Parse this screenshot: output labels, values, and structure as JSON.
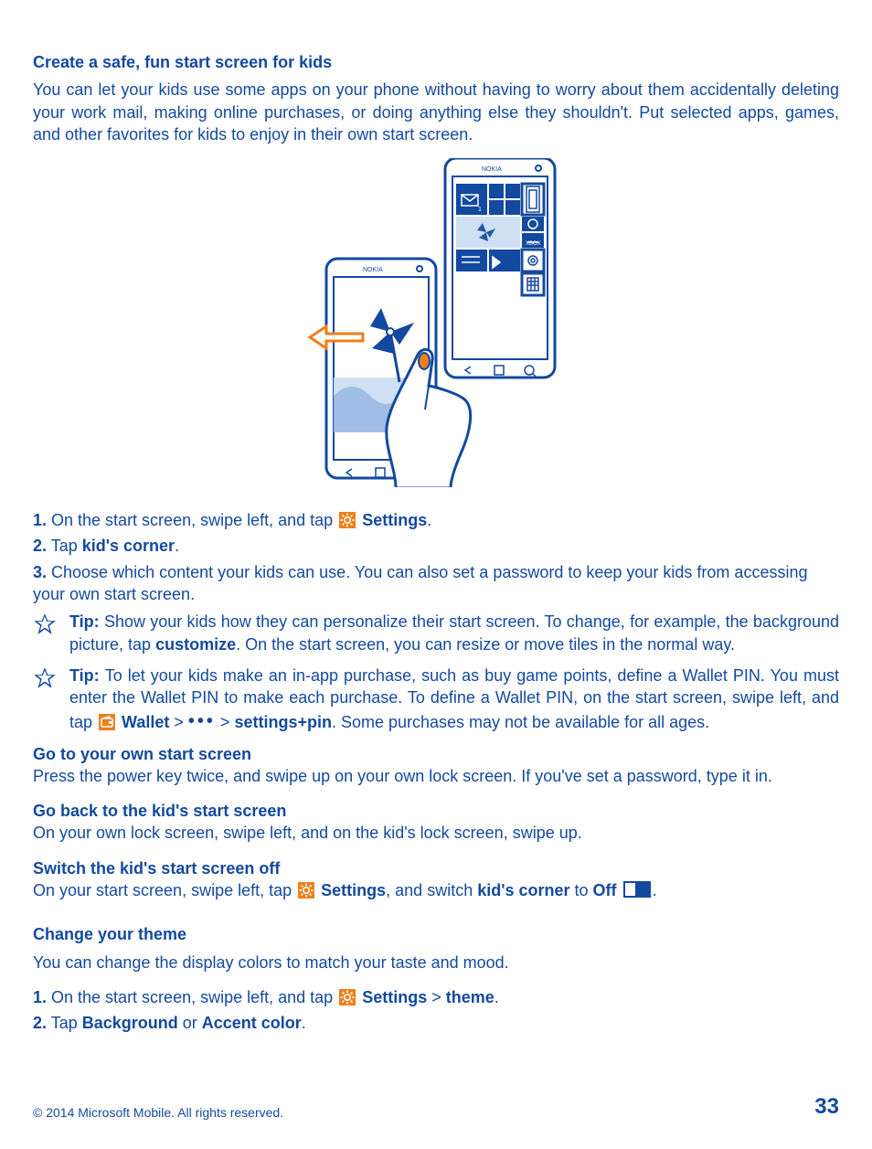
{
  "section1": {
    "heading": "Create a safe, fun start screen for kids",
    "intro": "You can let your kids use some apps on your phone without having to worry about them accidentally deleting your work mail, making online purchases, or doing anything else they shouldn't. Put selected apps, games, and other favorites for kids to enjoy in their own start screen.",
    "step1_a": "1.",
    "step1_b": " On the start screen, swipe left, and tap ",
    "step1_c": "Settings",
    "step1_d": ".",
    "step2_a": "2.",
    "step2_b": " Tap ",
    "step2_c": "kid's corner",
    "step2_d": ".",
    "step3_a": "3.",
    "step3_b": " Choose which content your kids can use. You can also set a password to keep your kids from accessing your own start screen.",
    "tip1_a": "Tip: ",
    "tip1_b": "Show your kids how they can personalize their start screen. To change, for example, the background picture, tap ",
    "tip1_c": "customize",
    "tip1_d": ". On the start screen, you can resize or move tiles in the normal way.",
    "tip2_a": "Tip: ",
    "tip2_b": "To let your kids make an in-app purchase, such as buy game points, define a Wallet PIN. You must enter the Wallet PIN to make each purchase. To define a Wallet PIN, on the start screen, swipe left, and tap ",
    "tip2_c": "Wallet",
    "tip2_d": " > ",
    "tip2_e": " > ",
    "tip2_f": "settings+pin",
    "tip2_g": ". Some purchases may not be available for all ages."
  },
  "sub1": {
    "head": "Go to your own start screen",
    "body": "Press the power key twice, and swipe up on your own lock screen. If you've set a password, type it in."
  },
  "sub2": {
    "head": "Go back to the kid's start screen",
    "body": "On your own lock screen, swipe left, and on the kid's lock screen, swipe up."
  },
  "sub3": {
    "head": "Switch the kid's start screen off",
    "body_a": "On your start screen, swipe left, tap ",
    "body_b": "Settings",
    "body_c": ", and switch ",
    "body_d": "kid's corner",
    "body_e": " to ",
    "body_f": "Off",
    "body_g": " "
  },
  "section2": {
    "heading": "Change your theme",
    "intro": "You can change the display colors to match your taste and mood.",
    "step1_a": "1.",
    "step1_b": " On the start screen, swipe left, and tap ",
    "step1_c": "Settings",
    "step1_d": " > ",
    "step1_e": "theme",
    "step1_f": ".",
    "step2_a": "2.",
    "step2_b": " Tap ",
    "step2_c": "Background",
    "step2_d": " or ",
    "step2_e": "Accent color",
    "step2_f": "."
  },
  "footer": {
    "copyright": "© 2014 Microsoft Mobile. All rights reserved.",
    "page": "33"
  },
  "icons": {
    "settings": "settings-icon",
    "wallet": "wallet-icon",
    "more": "•••"
  }
}
